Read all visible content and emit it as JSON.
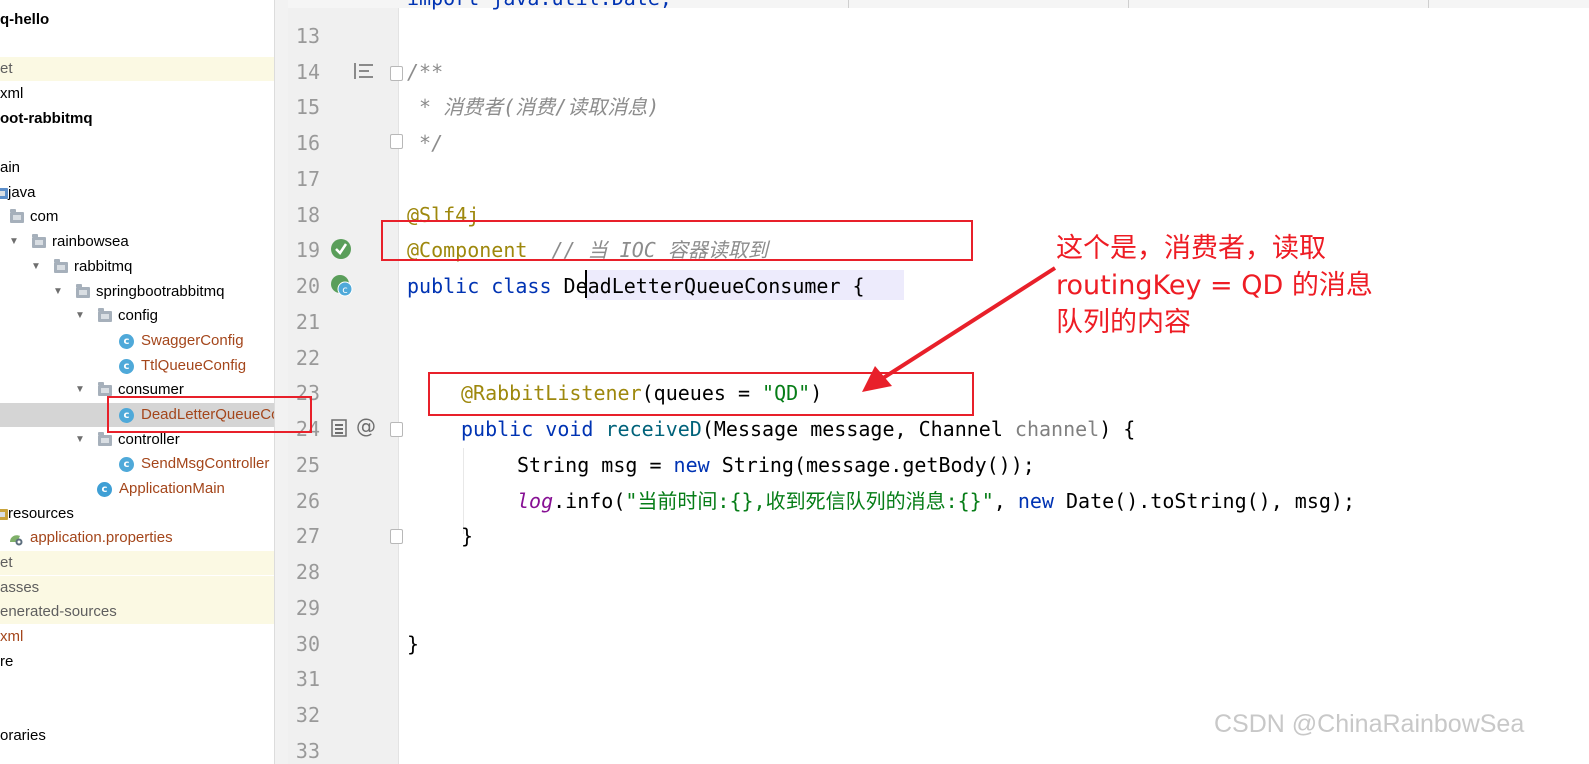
{
  "project_tree": {
    "rows": [
      {
        "label": "q-hello",
        "style": "bold"
      },
      {
        "label": "et",
        "style": "gray",
        "highlight": true
      },
      {
        "label": "xml",
        "style": "normal"
      },
      {
        "label": "oot-rabbitmq",
        "style": "bold"
      },
      {
        "label": "ain",
        "style": "normal"
      },
      {
        "label": "java",
        "style": "normal"
      },
      {
        "label": "com",
        "style": "normal"
      },
      {
        "label": "rainbowsea",
        "style": "normal"
      },
      {
        "label": "rabbitmq",
        "style": "normal"
      },
      {
        "label": "springbootrabbitmq",
        "style": "normal"
      },
      {
        "label": "config",
        "style": "normal"
      },
      {
        "label": "SwaggerConfig",
        "style": "brown"
      },
      {
        "label": "TtlQueueConfig",
        "style": "brown"
      },
      {
        "label": "consumer",
        "style": "normal"
      },
      {
        "label": "DeadLetterQueueCo",
        "style": "brown",
        "selected": true
      },
      {
        "label": "controller",
        "style": "normal"
      },
      {
        "label": "SendMsgController",
        "style": "brown"
      },
      {
        "label": "ApplicationMain",
        "style": "brown"
      },
      {
        "label": "resources",
        "style": "normal"
      },
      {
        "label": "application.properties",
        "style": "brown"
      },
      {
        "label": "et",
        "style": "gray",
        "highlight": true
      },
      {
        "label": "asses",
        "style": "gray",
        "highlight": true
      },
      {
        "label": "enerated-sources",
        "style": "gray",
        "highlight": true
      },
      {
        "label": "xml",
        "style": "brown"
      },
      {
        "label": "re",
        "style": "normal"
      },
      {
        "label": "oraries",
        "style": "normal"
      }
    ]
  },
  "editor": {
    "line_numbers": [
      "13",
      "14",
      "15",
      "16",
      "17",
      "18",
      "19",
      "20",
      "21",
      "22",
      "23",
      "24",
      "25",
      "26",
      "27",
      "28",
      "29",
      "30",
      "31",
      "32",
      "33"
    ],
    "top_partial_line": "import java.util.Date;",
    "code": {
      "l14": "/**",
      "l15": " * 消费者(消费/读取消息)",
      "l16": " */",
      "l18": "@Slf4j",
      "l19_ann": "@Component",
      "l19_cmt": "  // 当 IOC 容器读取到",
      "l20_kw": "public class ",
      "l20_name": "DeadLetterQueueConsumer",
      "l20_tail": " {",
      "l23_ann": "@RabbitListener",
      "l23_a": "(queues = ",
      "l23_str": "\"QD\"",
      "l23_b": ")",
      "l24_kw": "public void ",
      "l24_fn": "receiveD",
      "l24_a": "(Message message, Channel ",
      "l24_param": "channel",
      "l24_b": ") {",
      "l25_a": "String msg = ",
      "l25_kw": "new ",
      "l25_b": "String(message.getBody());",
      "l26_log": "log",
      "l26_a": ".info(",
      "l26_str": "\"当前时间:{},收到死信队列的消息:{}\"",
      "l26_b": ", ",
      "l26_kw": "new ",
      "l26_c": "Date().toString(), msg);",
      "l27": "}",
      "l30": "}"
    }
  },
  "annotation_note": {
    "line1": "这个是，消费者，读取",
    "line2": "routingKey = QD 的消息",
    "line3": "队列的内容"
  },
  "watermark": "CSDN @ChinaRainbowSea",
  "colors": {
    "annotation_red": "#ee1c24",
    "keyword": "#0033b3",
    "string": "#067d17",
    "annotation": "#9e880d",
    "comment": "#8c8c8c"
  }
}
